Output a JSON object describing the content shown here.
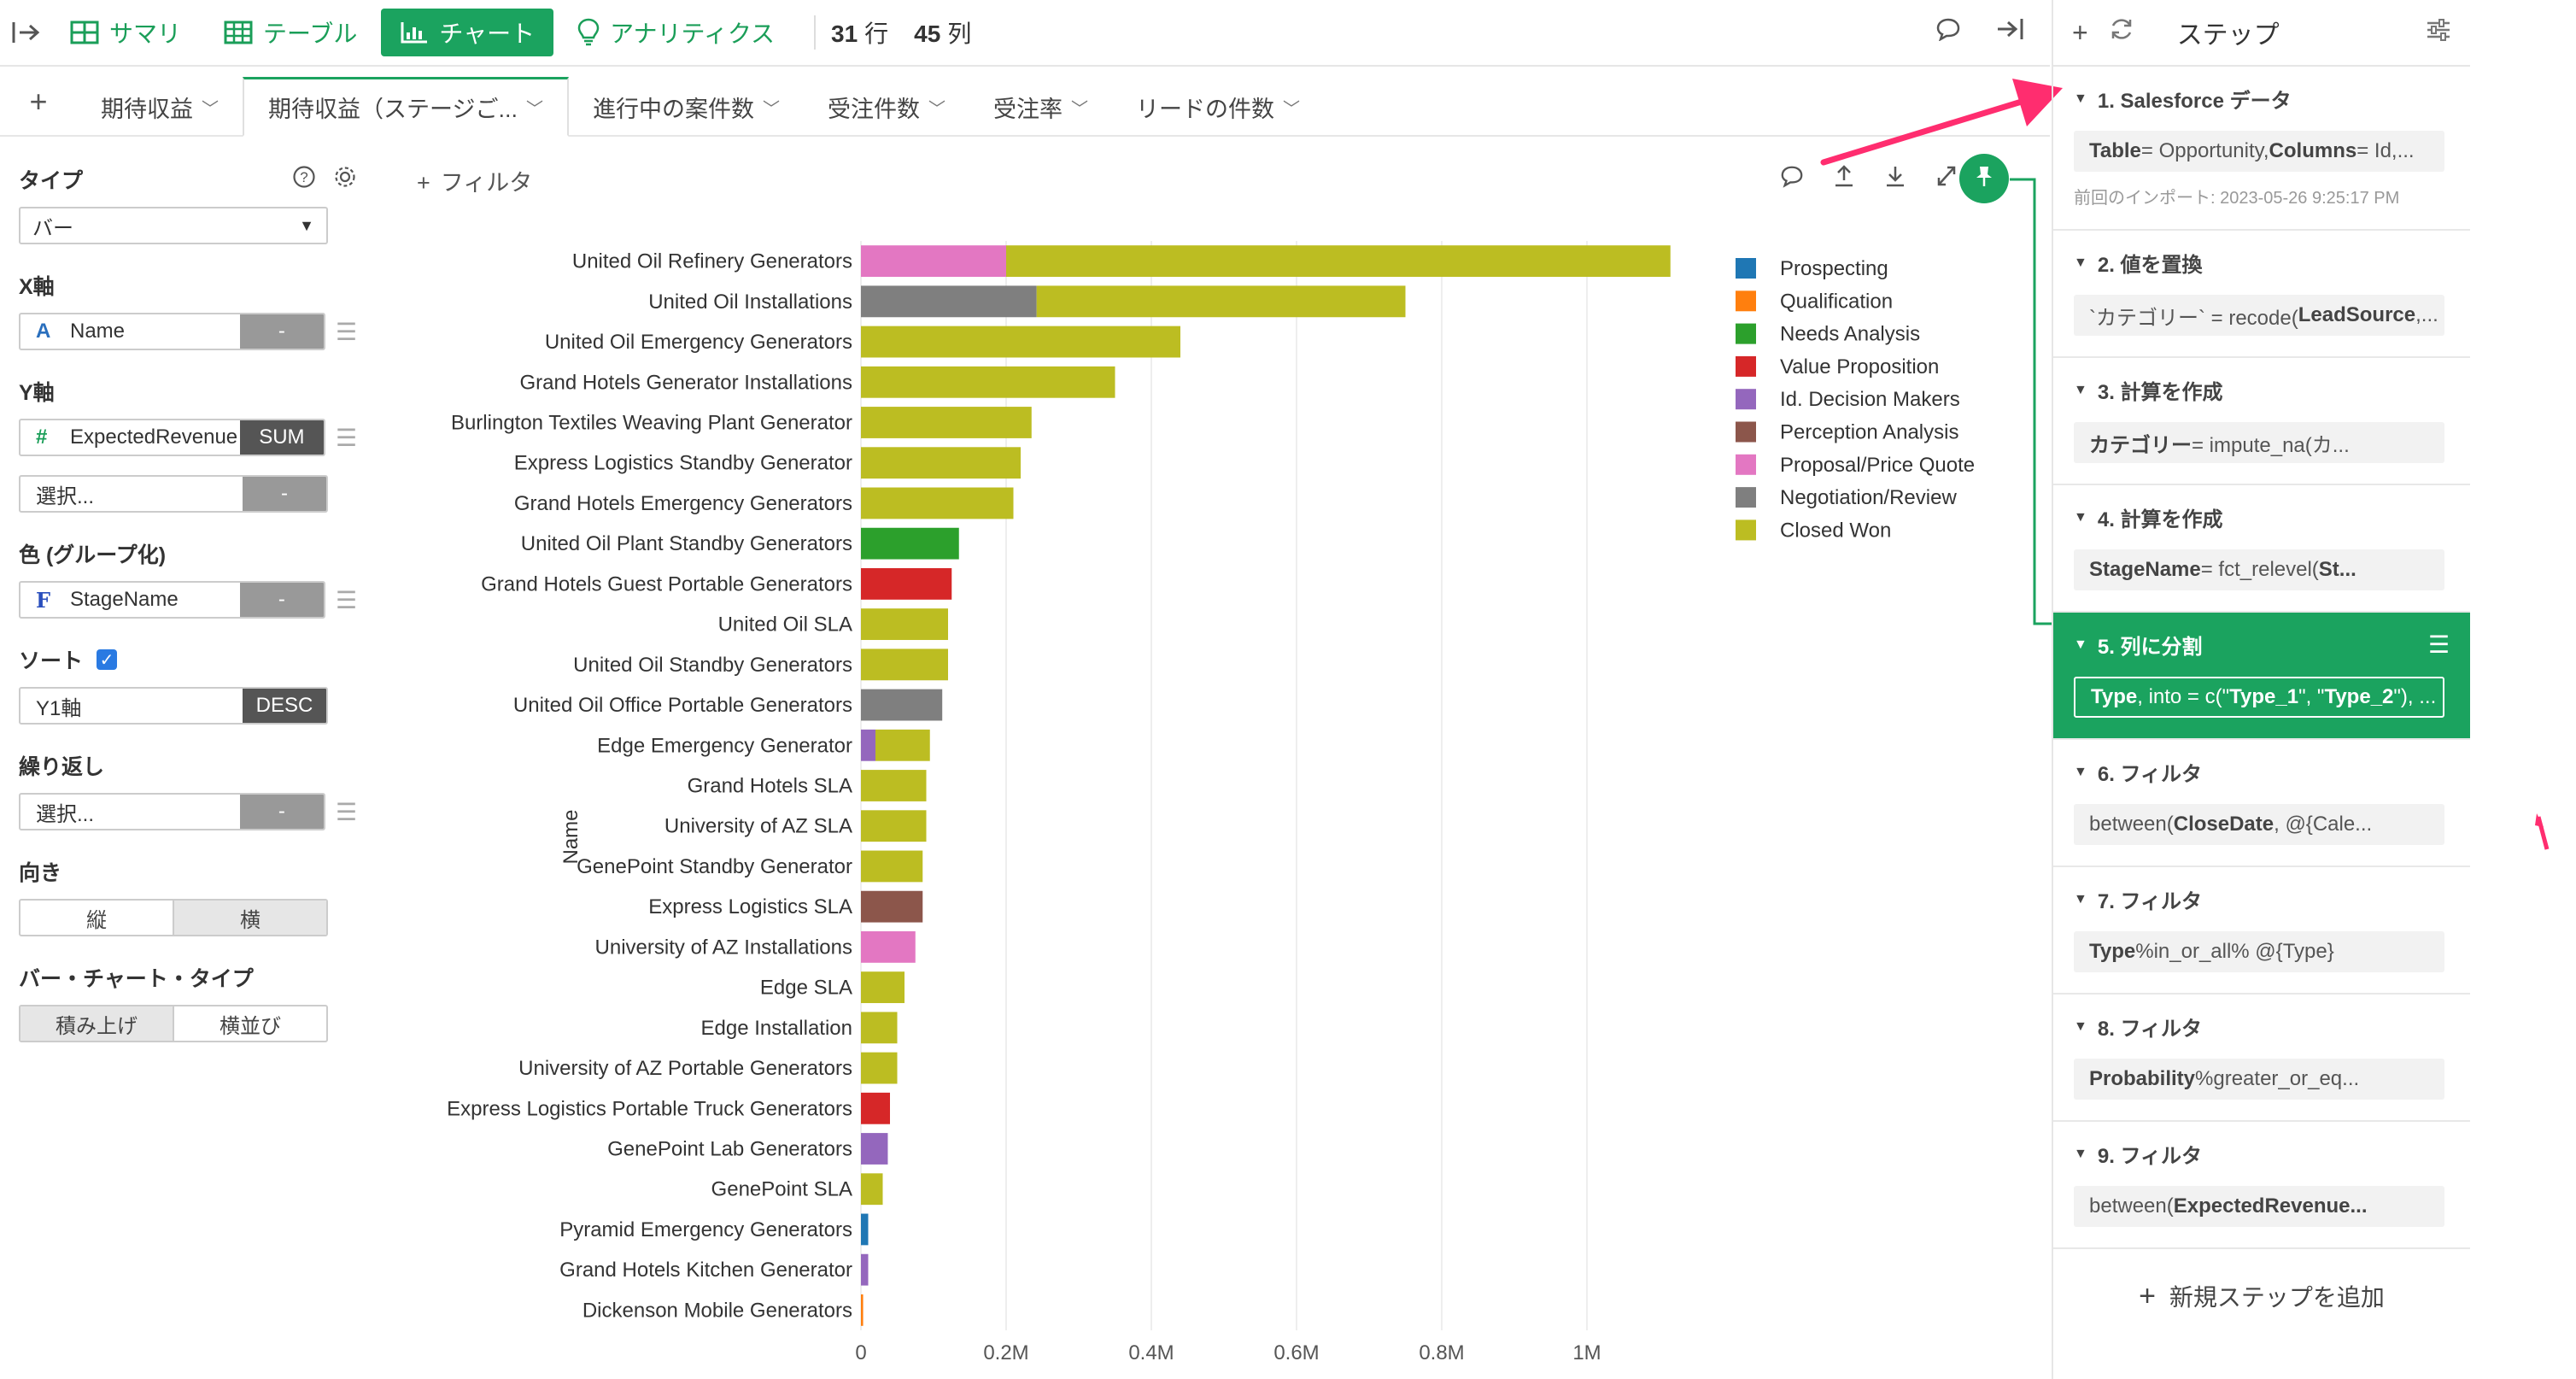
{
  "toolbar": {
    "tabs": [
      {
        "label": "サマリ",
        "icon": "grid-icon"
      },
      {
        "label": "テーブル",
        "icon": "table-icon"
      },
      {
        "label": "チャート",
        "icon": "bar-chart-icon"
      },
      {
        "label": "アナリティクス",
        "icon": "lightbulb-icon"
      }
    ],
    "rows_count": "31",
    "rows_label": "行",
    "cols_count": "45",
    "cols_label": "列"
  },
  "chart_tabs": [
    {
      "label": "期待収益"
    },
    {
      "label": "期待収益（ステージご..."
    },
    {
      "label": "進行中の案件数"
    },
    {
      "label": "受注件数"
    },
    {
      "label": "受注率"
    },
    {
      "label": "リードの件数"
    }
  ],
  "config": {
    "type_label": "タイプ",
    "type_value": "バー",
    "x_label": "X軸",
    "x_field": "Name",
    "x_agg": "-",
    "y_label": "Y軸",
    "y_field": "ExpectedRevenue",
    "y_agg": "SUM",
    "y2_placeholder": "選択...",
    "y2_agg": "-",
    "color_label": "色 (グループ化)",
    "color_field": "StageName",
    "color_agg": "-",
    "sort_label": "ソート",
    "sort_field": "Y1軸",
    "sort_order": "DESC",
    "repeat_label": "繰り返し",
    "repeat_placeholder": "選択...",
    "repeat_agg": "-",
    "orientation_label": "向き",
    "orientation_vertical": "縦",
    "orientation_horizontal": "横",
    "bar_type_label": "バー・チャート・タイプ",
    "bar_type_stacked": "積み上げ",
    "bar_type_grouped": "横並び"
  },
  "filter_label": "フィルタ",
  "colors": {
    "accent": "#1ba35f",
    "Prospecting": "#1f77b4",
    "Qualification": "#ff7f0e",
    "Needs Analysis": "#2ca02c",
    "Value Proposition": "#d62728",
    "Id. Decision Makers": "#9467bd",
    "Perception Analysis": "#8c564b",
    "Proposal/Price Quote": "#e377c2",
    "Negotiation/Review": "#7f7f7f",
    "Closed Won": "#bcbd22"
  },
  "chart_data": {
    "type": "bar",
    "orientation": "horizontal",
    "stacked": true,
    "ylabel": "Name",
    "xlim": [
      0,
      1120000
    ],
    "xticks": [
      0,
      200000,
      400000,
      600000,
      800000,
      1000000
    ],
    "xtick_labels": [
      "0",
      "0.2M",
      "0.4M",
      "0.6M",
      "0.8M",
      "1M"
    ],
    "legend_position": "right",
    "stages": [
      "Prospecting",
      "Qualification",
      "Needs Analysis",
      "Value Proposition",
      "Id. Decision Makers",
      "Perception Analysis",
      "Proposal/Price Quote",
      "Negotiation/Review",
      "Closed Won"
    ],
    "rows": [
      {
        "name": "United Oil Refinery Generators",
        "segments": [
          {
            "stage": "Proposal/Price Quote",
            "value": 200000
          },
          {
            "stage": "Closed Won",
            "value": 915000
          }
        ]
      },
      {
        "name": "United Oil Installations",
        "segments": [
          {
            "stage": "Negotiation/Review",
            "value": 242000
          },
          {
            "stage": "Closed Won",
            "value": 508000
          }
        ]
      },
      {
        "name": "United Oil Emergency Generators",
        "segments": [
          {
            "stage": "Closed Won",
            "value": 440000
          }
        ]
      },
      {
        "name": "Grand Hotels Generator Installations",
        "segments": [
          {
            "stage": "Closed Won",
            "value": 350000
          }
        ]
      },
      {
        "name": "Burlington Textiles Weaving Plant Generator",
        "segments": [
          {
            "stage": "Closed Won",
            "value": 235000
          }
        ]
      },
      {
        "name": "Express Logistics Standby Generator",
        "segments": [
          {
            "stage": "Closed Won",
            "value": 220000
          }
        ]
      },
      {
        "name": "Grand Hotels Emergency Generators",
        "segments": [
          {
            "stage": "Closed Won",
            "value": 210000
          }
        ]
      },
      {
        "name": "United Oil Plant Standby Generators",
        "segments": [
          {
            "stage": "Needs Analysis",
            "value": 135000
          }
        ]
      },
      {
        "name": "Grand Hotels Guest Portable Generators",
        "segments": [
          {
            "stage": "Value Proposition",
            "value": 125000
          }
        ]
      },
      {
        "name": "United Oil SLA",
        "segments": [
          {
            "stage": "Closed Won",
            "value": 120000
          }
        ]
      },
      {
        "name": "United Oil Standby Generators",
        "segments": [
          {
            "stage": "Closed Won",
            "value": 120000
          }
        ]
      },
      {
        "name": "United Oil Office Portable Generators",
        "segments": [
          {
            "stage": "Negotiation/Review",
            "value": 112000
          }
        ]
      },
      {
        "name": "Edge Emergency Generator",
        "segments": [
          {
            "stage": "Id. Decision Makers",
            "value": 20000
          },
          {
            "stage": "Closed Won",
            "value": 75000
          }
        ]
      },
      {
        "name": "Grand Hotels SLA",
        "segments": [
          {
            "stage": "Closed Won",
            "value": 90000
          }
        ]
      },
      {
        "name": "University of AZ SLA",
        "segments": [
          {
            "stage": "Closed Won",
            "value": 90000
          }
        ]
      },
      {
        "name": "GenePoint Standby Generator",
        "segments": [
          {
            "stage": "Closed Won",
            "value": 85000
          }
        ]
      },
      {
        "name": "Express Logistics SLA",
        "segments": [
          {
            "stage": "Perception Analysis",
            "value": 85000
          }
        ]
      },
      {
        "name": "University of AZ Installations",
        "segments": [
          {
            "stage": "Proposal/Price Quote",
            "value": 75000
          }
        ]
      },
      {
        "name": "Edge SLA",
        "segments": [
          {
            "stage": "Closed Won",
            "value": 60000
          }
        ]
      },
      {
        "name": "Edge Installation",
        "segments": [
          {
            "stage": "Closed Won",
            "value": 50000
          }
        ]
      },
      {
        "name": "University of AZ Portable Generators",
        "segments": [
          {
            "stage": "Closed Won",
            "value": 50000
          }
        ]
      },
      {
        "name": "Express Logistics Portable Truck Generators",
        "segments": [
          {
            "stage": "Value Proposition",
            "value": 40000
          }
        ]
      },
      {
        "name": "GenePoint Lab Generators",
        "segments": [
          {
            "stage": "Id. Decision Makers",
            "value": 37000
          }
        ]
      },
      {
        "name": "GenePoint SLA",
        "segments": [
          {
            "stage": "Closed Won",
            "value": 30000
          }
        ]
      },
      {
        "name": "Pyramid Emergency Generators",
        "segments": [
          {
            "stage": "Prospecting",
            "value": 10000
          }
        ]
      },
      {
        "name": "Grand Hotels Kitchen Generator",
        "segments": [
          {
            "stage": "Id. Decision Makers",
            "value": 10000
          }
        ]
      },
      {
        "name": "Dickenson Mobile Generators",
        "segments": [
          {
            "stage": "Qualification",
            "value": 3000
          }
        ]
      }
    ]
  },
  "steps_panel": {
    "title": "ステップ",
    "add_step_label": "新規ステップを追加",
    "steps": [
      {
        "title": "1. Salesforce データ",
        "body_parts": [
          [
            "Table",
            true
          ],
          [
            " = Opportunity, ",
            false
          ],
          [
            "Columns",
            true
          ],
          [
            " = Id,...",
            false
          ]
        ],
        "meta": "前回のインポート: 2023-05-26 9:25:17 PM"
      },
      {
        "title": "2. 値を置換",
        "body_parts": [
          [
            "`カテゴリー` = recode(",
            false
          ],
          [
            "LeadSource",
            true
          ],
          [
            ",...",
            false
          ]
        ]
      },
      {
        "title": "3. 計算を作成",
        "body_parts": [
          [
            "カテゴリー",
            true
          ],
          [
            " = impute_na(カ...",
            false
          ]
        ]
      },
      {
        "title": "4. 計算を作成",
        "body_parts": [
          [
            "StageName",
            true
          ],
          [
            " = fct_relevel(",
            false
          ],
          [
            "St...",
            true
          ]
        ]
      },
      {
        "title": "5. 列に分割",
        "active": true,
        "body_parts": [
          [
            "Type",
            true
          ],
          [
            ", into = c(\"",
            false
          ],
          [
            "Type_1",
            true
          ],
          [
            "\", \"",
            false
          ],
          [
            "Type_2",
            true
          ],
          [
            "\"), ...",
            false
          ]
        ]
      },
      {
        "title": "6. フィルタ",
        "body_parts": [
          [
            "between(",
            false
          ],
          [
            "CloseDate",
            true
          ],
          [
            ", @{Cale...",
            false
          ]
        ]
      },
      {
        "title": "7. フィルタ",
        "body_parts": [
          [
            "Type",
            true
          ],
          [
            " %in_or_all% @{Type}",
            false
          ]
        ]
      },
      {
        "title": "8. フィルタ",
        "body_parts": [
          [
            "Probability",
            true
          ],
          [
            " %greater_or_eq...",
            false
          ]
        ]
      },
      {
        "title": "9. フィルタ",
        "body_parts": [
          [
            "between(",
            false
          ],
          [
            "ExpectedRevenue...",
            true
          ]
        ]
      }
    ]
  }
}
